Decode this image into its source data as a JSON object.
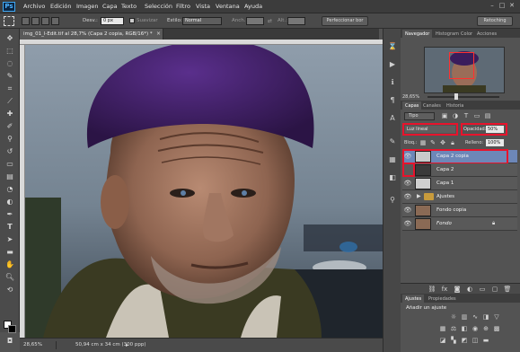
{
  "app": {
    "logo": "Ps"
  },
  "menu": [
    "Archivo",
    "Edición",
    "Imagen",
    "Capa",
    "Texto",
    "Selección",
    "Filtro",
    "Vista",
    "Ventana",
    "Ayuda"
  ],
  "window_controls": [
    "–",
    "□",
    "✕"
  ],
  "options": {
    "desv_label": "Desv.:",
    "desv_value": "0 px",
    "suavizar_label": "Suavizar",
    "estilo_label": "Estilo:",
    "estilo_value": "Normal",
    "anch_label": "Anch.:",
    "alt_label": "Alt.:",
    "refine_button": "Perfeccionar bor",
    "workspace_button": "Retoching"
  },
  "document_tab": "img_01_l-Edit.tif al 28,7% (Capa 2 copia, RGB/16*) *",
  "status": {
    "zoom": "28,65%",
    "doc_size": "50,94 cm x 34 cm (300 ppp)"
  },
  "navigator": {
    "tabs": [
      "Navegador",
      "Histogram",
      "Color",
      "Acciones"
    ],
    "zoom": "28,65%"
  },
  "layers_panel": {
    "tabs": [
      "Capas",
      "Canales",
      "Historia"
    ],
    "kind_label": "Tipo",
    "blend_mode": "Luz lineal",
    "opacity_label": "Opacidad:",
    "opacity_value": "50%",
    "lock_label": "Bloq.:",
    "fill_label": "Relleno:",
    "fill_value": "100%",
    "layers": [
      {
        "name": "Capa 2 copia",
        "thumb_color": "#c9c9c9",
        "visible": true,
        "selected": true,
        "italic": false
      },
      {
        "name": "Capa 2",
        "thumb_color": "#3a3a3a",
        "visible": false,
        "selected": false,
        "italic": false
      },
      {
        "name": "Capa 1",
        "thumb_color": "#cfcfcf",
        "visible": true,
        "selected": false,
        "italic": false
      },
      {
        "name": "Ajustes",
        "thumb_color": "",
        "visible": true,
        "selected": false,
        "italic": false
      },
      {
        "name": "Fondo copia",
        "thumb_color": "#8a6a55",
        "visible": true,
        "selected": false,
        "italic": false
      },
      {
        "name": "Fondo",
        "thumb_color": "#8a6a55",
        "visible": true,
        "selected": false,
        "italic": true
      }
    ]
  },
  "adjustments_panel": {
    "tabs": [
      "Ajustes",
      "Propiedades"
    ],
    "title": "Añadir un ajuste"
  },
  "colors": {
    "selection_highlight": "#e8132c",
    "selected_layer": "#6d87b8"
  }
}
